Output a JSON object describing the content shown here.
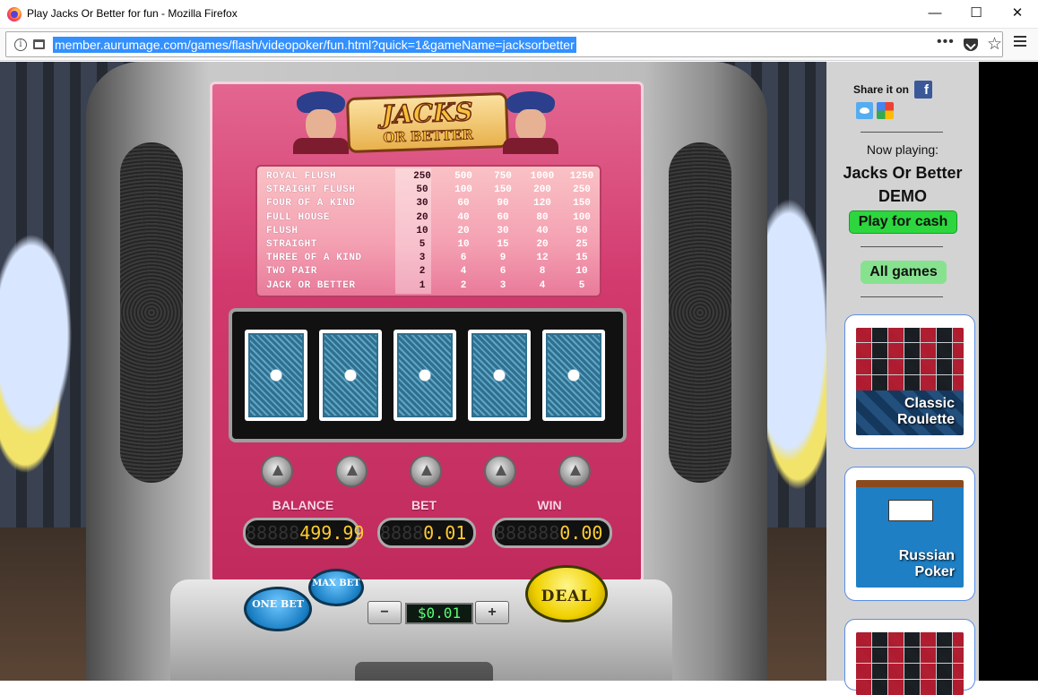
{
  "window": {
    "title": "Play Jacks Or Better for fun - Mozilla Firefox",
    "minimize": "—",
    "maximize": "☐",
    "close": "✕"
  },
  "browser": {
    "url": "member.aurumage.com/games/flash/videopoker/fun.html?quick=1&gameName=jacksorbetter",
    "dots": "•••",
    "star": "☆"
  },
  "game": {
    "logo_line1": "JACKS",
    "logo_line2": "OR BETTER",
    "paytable": [
      {
        "hand": "ROYAL FLUSH",
        "payouts": [
          "250",
          "500",
          "750",
          "1000",
          "1250"
        ]
      },
      {
        "hand": "STRAIGHT FLUSH",
        "payouts": [
          "50",
          "100",
          "150",
          "200",
          "250"
        ]
      },
      {
        "hand": "FOUR OF A KIND",
        "payouts": [
          "30",
          "60",
          "90",
          "120",
          "150"
        ]
      },
      {
        "hand": "FULL HOUSE",
        "payouts": [
          "20",
          "40",
          "60",
          "80",
          "100"
        ]
      },
      {
        "hand": "FLUSH",
        "payouts": [
          "10",
          "20",
          "30",
          "40",
          "50"
        ]
      },
      {
        "hand": "STRAIGHT",
        "payouts": [
          "5",
          "10",
          "15",
          "20",
          "25"
        ]
      },
      {
        "hand": "THREE OF A KIND",
        "payouts": [
          "3",
          "6",
          "9",
          "12",
          "15"
        ]
      },
      {
        "hand": "TWO PAIR",
        "payouts": [
          "2",
          "4",
          "6",
          "8",
          "10"
        ]
      },
      {
        "hand": "JACK OR BETTER",
        "payouts": [
          "1",
          "2",
          "3",
          "4",
          "5"
        ]
      }
    ],
    "balance_label": "BALANCE",
    "bet_label": "BET",
    "win_label": "WIN",
    "balance_ghost": "88888",
    "balance_value": "499.99",
    "bet_ghost": "8888",
    "bet_value": "0.01",
    "win_ghost": "888888",
    "win_value": "0.00",
    "one_bet_label": "ONE BET",
    "max_bet_label": "MAX BET",
    "deal_label": "DEAL",
    "minus": "−",
    "plus": "+",
    "coin_value": "$0.01"
  },
  "sidebar": {
    "share_label": "Share it on",
    "facebook_glyph": "f",
    "now_playing_label": "Now playing:",
    "game_title": "Jacks Or Better DEMO",
    "play_cash_label": "Play for cash",
    "all_games_label": "All games",
    "thumbnails": [
      {
        "label": "Classic Roulette"
      },
      {
        "label": "Russian Poker"
      }
    ]
  },
  "colors": {
    "accent_url_highlight": "#3390ff",
    "play_cash_green": "#2dd63e",
    "all_games_green": "#86e28f",
    "meter_digits": "#ffcc33"
  }
}
